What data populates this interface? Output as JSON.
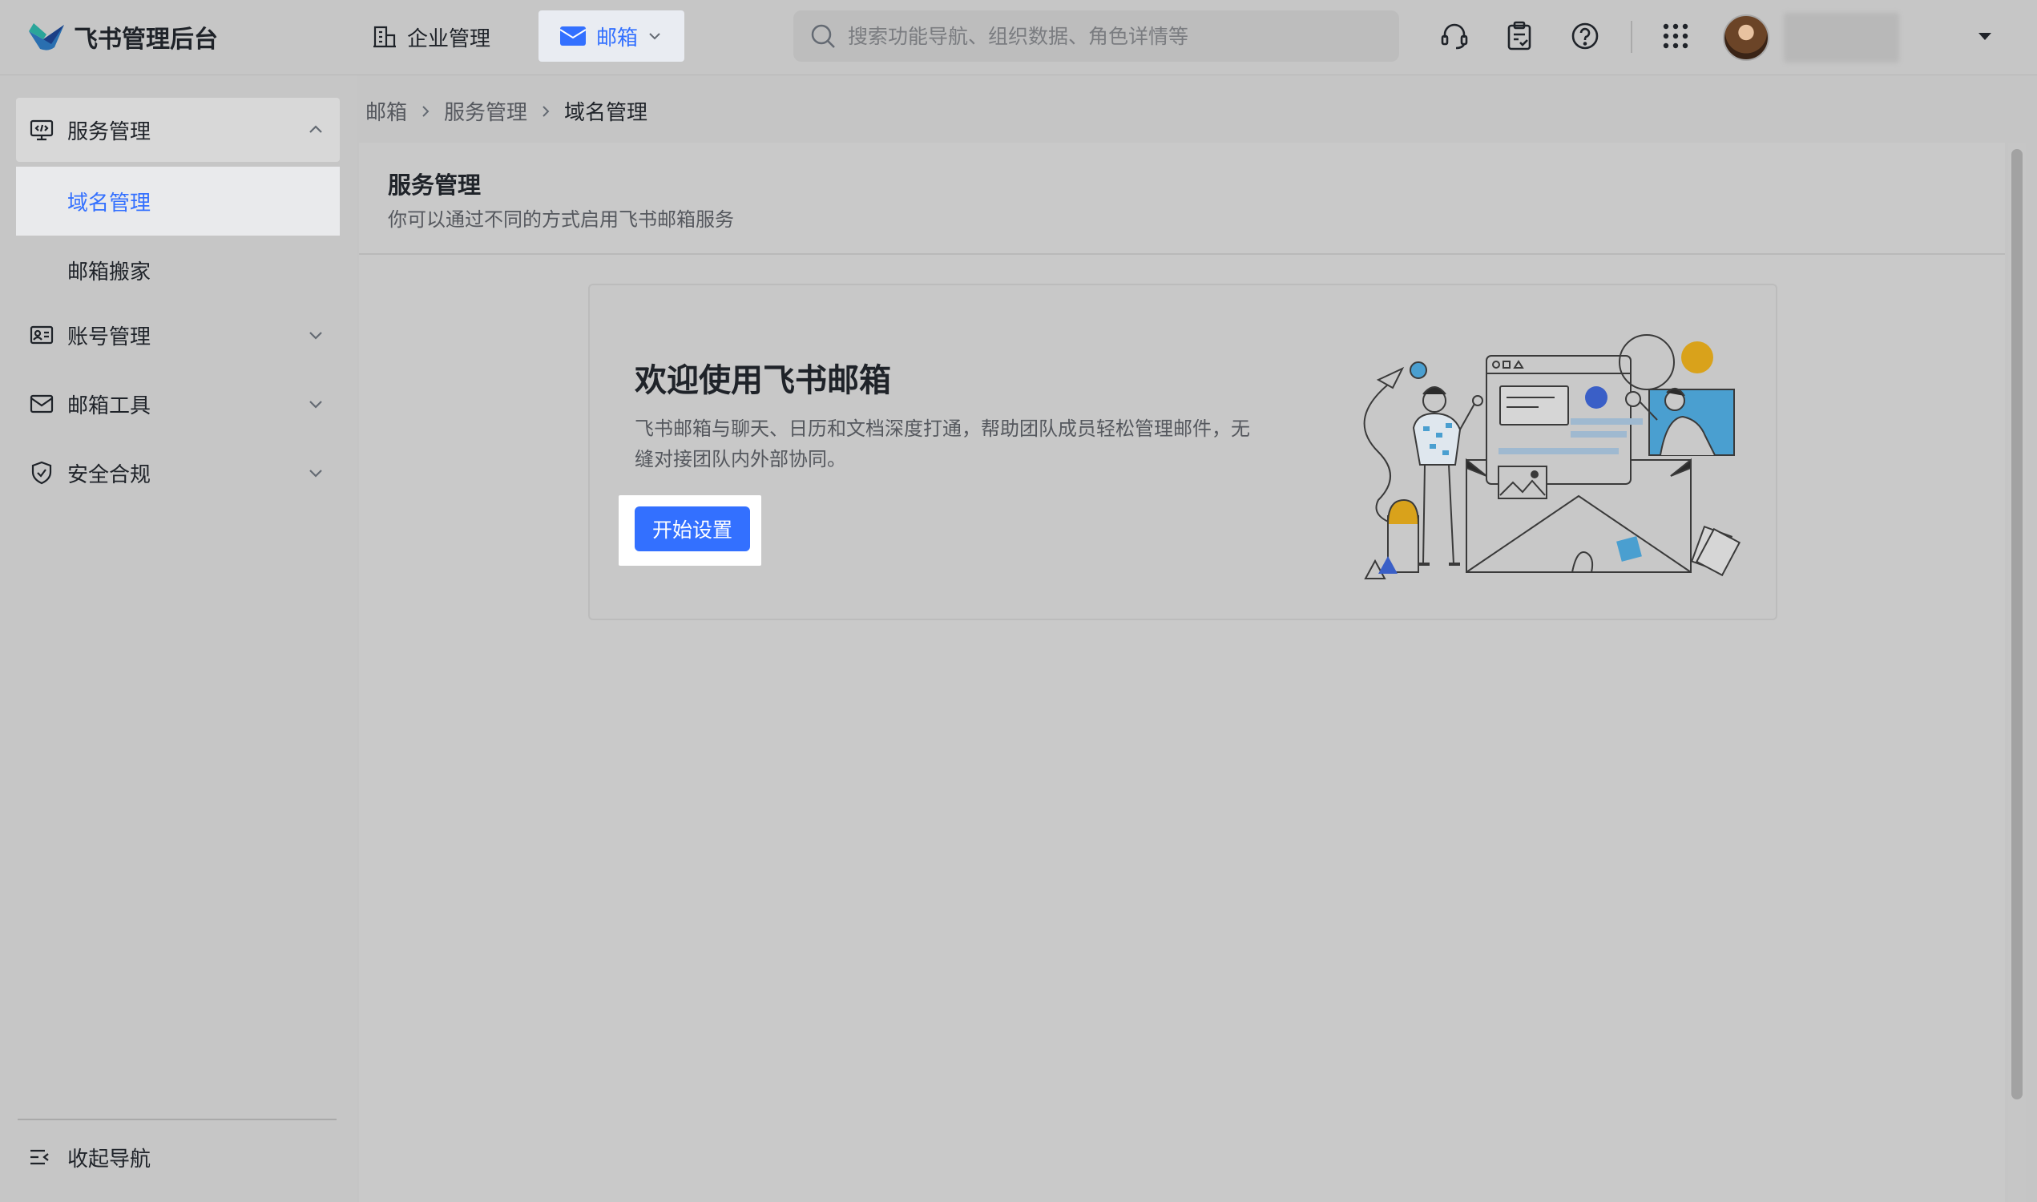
{
  "header": {
    "logo_text": "飞书管理后台",
    "nav_org_label": "企业管理",
    "nav_mail_label": "邮箱",
    "search_placeholder": "搜索功能导航、组织数据、角色详情等",
    "icons": [
      "headset-icon",
      "clipboard-check-icon",
      "help-icon",
      "app-grid-icon"
    ],
    "username": ""
  },
  "sidebar": {
    "groups": [
      {
        "label": "服务管理",
        "icon": "monitor-code-icon",
        "expanded": true,
        "items": [
          {
            "label": "域名管理",
            "selected": true
          },
          {
            "label": "邮箱搬家",
            "selected": false
          }
        ]
      },
      {
        "label": "账号管理",
        "icon": "id-card-icon",
        "expanded": false
      },
      {
        "label": "邮箱工具",
        "icon": "mail-icon",
        "expanded": false
      },
      {
        "label": "安全合规",
        "icon": "shield-check-icon",
        "expanded": false
      }
    ],
    "collapse_label": "收起导航"
  },
  "breadcrumb": [
    "邮箱",
    "服务管理",
    "域名管理"
  ],
  "page": {
    "title": "服务管理",
    "subtitle": "你可以通过不同的方式启用飞书邮箱服务"
  },
  "welcome": {
    "title": "欢迎使用飞书邮箱",
    "desc": "飞书邮箱与聊天、日历和文档深度打通，帮助团队成员轻松管理邮件，无缝对接团队内外部协同。",
    "button_label": "开始设置"
  },
  "colors": {
    "accent": "#3370ff",
    "illustration_blue": "#4a9fd0",
    "illustration_yellow": "#d9a21b"
  }
}
